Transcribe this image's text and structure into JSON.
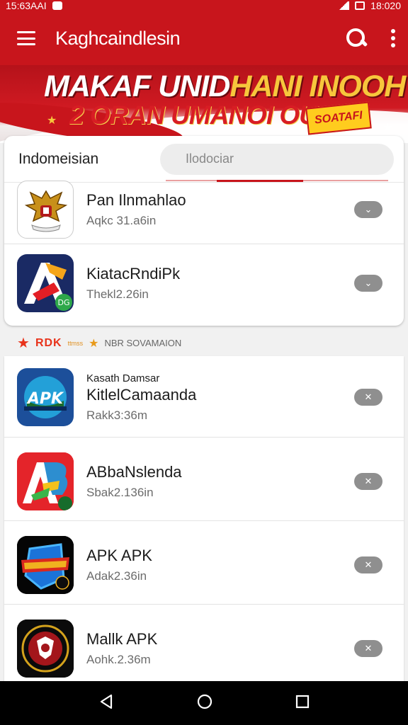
{
  "status_bar": {
    "time": "15:63AAI",
    "clock": "18:020"
  },
  "app_bar": {
    "title": "Kaghcaindlesin"
  },
  "banner": {
    "line1_white": "MAKAF UNID",
    "line1_gold": "HANI INOOH",
    "line2": "2 ORAN UMANOI OUM",
    "sticker": "SOATAFI"
  },
  "card1": {
    "title": "Indomeisian",
    "search_value": "Ilodociar",
    "items": [
      {
        "name": "Pan Ilnmahlao",
        "sub": "Aqkc 31.a6in"
      },
      {
        "name": "KiatacRndiPk",
        "sub": "Thekl2.26in"
      }
    ]
  },
  "section": {
    "badge": "RDK",
    "small": "ttmss",
    "label": "NBR SOVAMAION"
  },
  "card2": {
    "items": [
      {
        "pre": "Kasath Damsar",
        "name": "KitlelCamaanda",
        "sub": "Rakk3:36m"
      },
      {
        "name": "ABbaNslenda",
        "sub": "Sbak2.136in"
      },
      {
        "name": "APK APK",
        "sub": "Adak2.36in"
      },
      {
        "name": "Mallk APK",
        "sub": "Aohk.2.36m"
      }
    ]
  },
  "icons": {
    "app1": "garuda-emblem-icon",
    "app2": "letter-a-logo-icon",
    "app3": "apk-globe-icon",
    "app4": "letter-ab-logo-icon",
    "app5": "shield-logo-icon",
    "app6": "round-emblem-icon"
  },
  "colors": {
    "brand_red": "#c8151c",
    "accent_gold": "#f7c63c",
    "button_grey": "#8f8f8f"
  }
}
